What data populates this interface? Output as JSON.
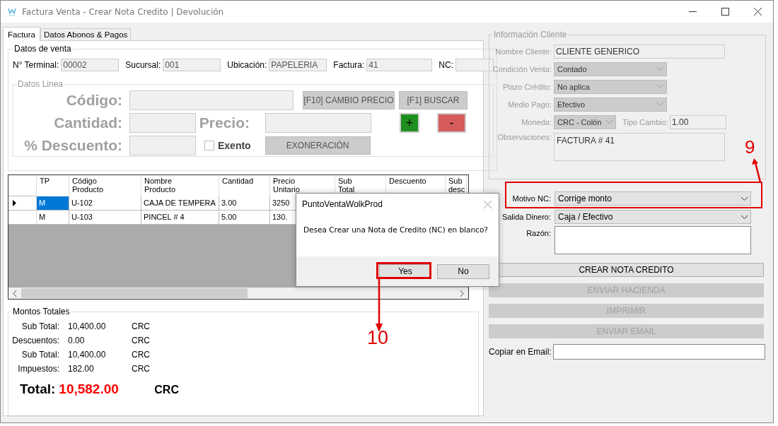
{
  "window": {
    "title": "Factura Venta - Crear Nota Credito | Devolución"
  },
  "tabs": [
    {
      "label": "Factura",
      "selected": true
    },
    {
      "label": "Datos Abonos & Pagos",
      "selected": false
    }
  ],
  "datos_venta": {
    "title": "Datos de venta",
    "fields": [
      {
        "label": "N° Terminal:",
        "value": "00002"
      },
      {
        "label": "Sucursal:",
        "value": "001"
      },
      {
        "label": "Ubicación:",
        "value": "PAPELERIA"
      },
      {
        "label": "Factura:",
        "value": "41"
      },
      {
        "label": "NC:"
      }
    ]
  },
  "datos_linea": {
    "title": "Datos Linea",
    "disabled": true,
    "codigo_label": "Código:",
    "cantidad_label": "Cantidad:",
    "precio_label": "Precio:",
    "descuento_label": "% Descuento:",
    "exento": {
      "label": "Exento",
      "checked": false
    },
    "cambio_precio": "[F10] CAMBIO PRECIO",
    "buscar": "[F1] BUSCAR",
    "add": "+",
    "remove": "-",
    "exoneracion": "EXONERACIÓN"
  },
  "table": {
    "columns": [
      "TP",
      "Código Producto",
      "Nombre Producto",
      "Cantidad",
      "Precio Unitario",
      "Sub Total",
      "Descuento",
      "Sub desc"
    ],
    "rows": [
      {
        "selected": true,
        "cells": [
          "M",
          "U-102",
          "CAJA DE TEMPERA",
          "3.00",
          "3250"
        ]
      },
      {
        "selected": false,
        "cells": [
          "M",
          "U-103",
          "PINCEL # 4",
          "5.00",
          "130."
        ]
      }
    ]
  },
  "montos": {
    "title": "Montos Totales",
    "lines": [
      {
        "label": "Sub Total:",
        "value": "10,400.00",
        "currency": "CRC"
      },
      {
        "label": "Descuentos:",
        "value": "0.00",
        "currency": "CRC"
      },
      {
        "label": "Sub Total:",
        "value": "10,400.00",
        "currency": "CRC"
      },
      {
        "label": "Impuestos:",
        "value": "182.00",
        "currency": "CRC"
      }
    ],
    "total": {
      "label": "Total:",
      "value": "10,582.00",
      "currency": "CRC"
    }
  },
  "cliente": {
    "title": "Información Cliente",
    "disabled": true,
    "rows": [
      {
        "kind": "text",
        "label": "Nombre Cliente:",
        "value": "CLIENTE GENERICO"
      },
      {
        "kind": "select",
        "label": "Condición Venta:",
        "value": "Contado"
      },
      {
        "kind": "select",
        "label": "Plazo Crédito:",
        "value": "No aplica"
      },
      {
        "kind": "select",
        "label": "Medio Pago:",
        "value": "Efectivo"
      },
      {
        "kind": "select",
        "label": "Moneda:",
        "value": "CRC - Colón",
        "extra": {
          "label": "Tipo Cambio:",
          "value": "1.00"
        }
      },
      {
        "kind": "textarea",
        "label": "Observaciones:",
        "value": "FACTURA  # 41"
      }
    ]
  },
  "nota": {
    "rows": [
      {
        "kind": "select",
        "label": "Motivo NC:",
        "value": "Corrige monto"
      },
      {
        "kind": "select",
        "label": "Salida Dinero:",
        "value": "Caja / Efectivo"
      },
      {
        "kind": "textarea",
        "label": "Razón:"
      }
    ],
    "buttons": [
      {
        "label": "CREAR NOTA CREDITO",
        "disabled": false
      },
      {
        "label": "ENVIAR HACIENDA",
        "disabled": true
      },
      {
        "label": "IMPRIMIR",
        "disabled": true
      },
      {
        "label": "ENVIAR EMAIL",
        "disabled": true
      }
    ],
    "email_label": "Copiar en Email:"
  },
  "dialog": {
    "title": "PuntoVentaWolkProd",
    "message": "Desea Crear una Nota de Credito (NC) en blanco?",
    "buttons": [
      "Yes",
      "No"
    ]
  },
  "annotations": [
    {
      "label": "9"
    },
    {
      "label": "10"
    }
  ]
}
